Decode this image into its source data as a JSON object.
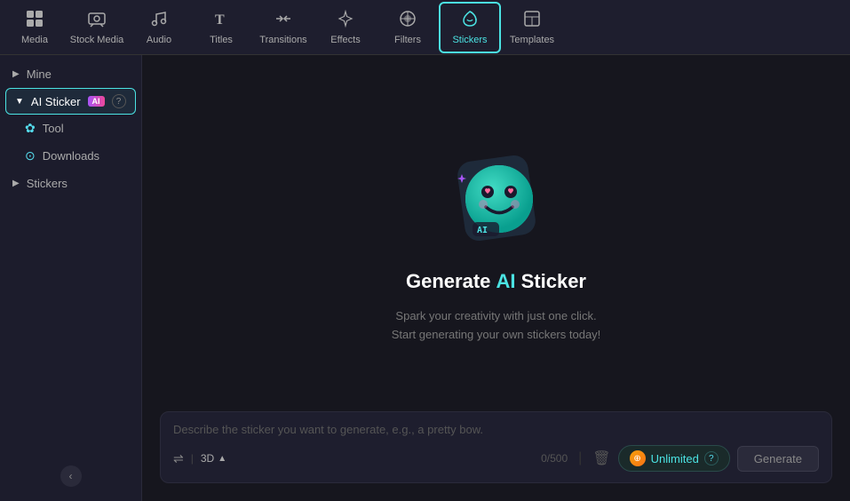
{
  "nav": {
    "items": [
      {
        "id": "media",
        "label": "Media",
        "icon": "⊞",
        "active": false
      },
      {
        "id": "stock-media",
        "label": "Stock Media",
        "icon": "🎞",
        "active": false
      },
      {
        "id": "audio",
        "label": "Audio",
        "icon": "♪",
        "active": false
      },
      {
        "id": "titles",
        "label": "Titles",
        "icon": "T",
        "active": false
      },
      {
        "id": "transitions",
        "label": "Transitions",
        "icon": "⇄",
        "active": false
      },
      {
        "id": "effects",
        "label": "Effects",
        "icon": "✦",
        "active": false
      },
      {
        "id": "filters",
        "label": "Filters",
        "icon": "◈",
        "active": false
      },
      {
        "id": "stickers",
        "label": "Stickers",
        "icon": "✦",
        "active": true
      },
      {
        "id": "templates",
        "label": "Templates",
        "icon": "▦",
        "active": false
      }
    ]
  },
  "sidebar": {
    "items": [
      {
        "id": "mine",
        "label": "Mine",
        "hasArrow": true,
        "active": false
      },
      {
        "id": "ai-sticker",
        "label": "AI Sticker",
        "hasArrow": true,
        "active": true,
        "badge": "AI"
      },
      {
        "id": "tool",
        "label": "Tool",
        "active": false,
        "sub": true
      },
      {
        "id": "downloads",
        "label": "Downloads",
        "active": false,
        "sub": true
      },
      {
        "id": "stickers",
        "label": "Stickers",
        "hasArrow": true,
        "active": false
      }
    ],
    "collapse_icon": "‹"
  },
  "hero": {
    "title_prefix": "Generate ",
    "title_ai": "AI",
    "title_suffix": " Sticker",
    "subtitle_line1": "Spark your creativity with just one click.",
    "subtitle_line2": "Start generating your own stickers today!"
  },
  "input": {
    "placeholder": "Describe the sticker you want to generate, e.g., a pretty bow.",
    "style_label": "3D",
    "char_count": "0/500",
    "unlimited_label": "Unlimited",
    "generate_label": "Generate"
  }
}
